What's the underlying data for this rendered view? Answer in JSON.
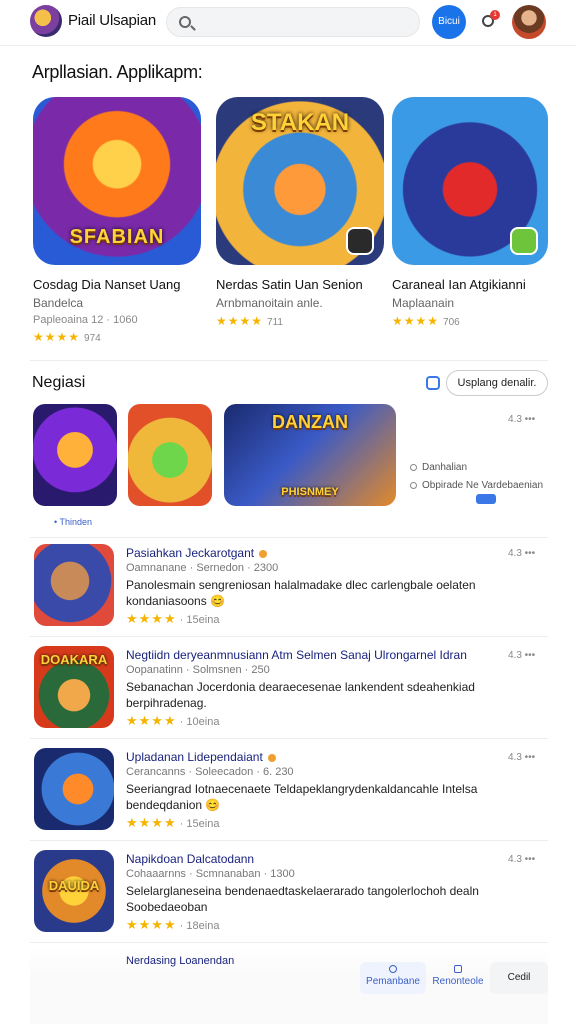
{
  "header": {
    "app_title": "Piail Ulsapian",
    "search_placeholder": "",
    "action_label": "Bicui",
    "notification_count": "1"
  },
  "featured": {
    "title": "Arpllasian. Applikapm:",
    "apps": [
      {
        "art_top": "",
        "art_bottom": "SFABIAN",
        "name": "Cosdag Dia Nanset Uang",
        "developer": "Bandelca",
        "meta": "Papleoaina 12 · 1060",
        "stars": "★★★★",
        "rating": "974"
      },
      {
        "art_top": "STAKAN",
        "art_bottom": "",
        "name": "Nerdas Satin Uan Senion",
        "developer": "Arnbmanoitain anle.",
        "meta": "",
        "stars": "★★★★",
        "rating": "711"
      },
      {
        "art_top": "",
        "art_bottom": "",
        "name": "Caraneal Ian Atgikianni",
        "developer": "Maplaanain",
        "meta": "",
        "stars": "★★★★",
        "rating": "706"
      }
    ]
  },
  "secondary": {
    "title": "Negiasi",
    "button_label": "Usplang denalir.",
    "banner_top": "DANZAN",
    "banner_bottom": "PHISNMEY",
    "rank": "4.3 •••",
    "info1": "Danhalian",
    "info2": "Obpirade Ne Vardebaenian",
    "link": "• Thinden"
  },
  "list": [
    {
      "icon_text": "",
      "title": "Pasiahkan Jeckarotgant",
      "meta": "Oamnanane · Sernedon · 2300",
      "desc": "Panolesmain sengreniosan halalmadake dlec carlengbale oelaten kondaniasoons 😊",
      "stars": "★★★★",
      "rating": "15eina",
      "rank": "4.3 •••"
    },
    {
      "icon_text": "DOAKARA",
      "title": "Negtiidn deryeanmnusiann Atm Selmen Sanaj Ulrongarnel Idran",
      "meta": "Oopanatinn · Solmsnen · 250",
      "desc": "Sebanachan Jocerdonia dearaecesenae lankendent sdeahenkiad berpihradenag.",
      "stars": "★★★★",
      "rating": "10eina",
      "rank": "4.3 •••"
    },
    {
      "icon_text": "",
      "title": "Upladanan Lidependaiant",
      "meta": "Cerancanns · Soleecadon · 6. 230",
      "desc": "Seeriangrad Iotnaecenaete Teldapeklangrydenkaldancahle Intelsa bendeqdanion 😊",
      "stars": "★★★★",
      "rating": "15eina",
      "rank": "4.3 •••"
    },
    {
      "icon_text": "DAUIDA",
      "title": "Napikdoan Dalcatodann",
      "meta": "Cohaaarnns · Scmnanaban · 1300",
      "desc": "Selelarglaneseina bendenaedtaskelaerarado tangolerlochoh dealn Soobedaeoban",
      "stars": "★★★★",
      "rating": "18eina",
      "rank": "4.3 •••"
    }
  ],
  "partial_row_title": "Nerdasing Loanendan",
  "bottom_bar": {
    "btn1": "Pemanbane",
    "btn2": "Renonteole",
    "btn3": "Cedil"
  }
}
